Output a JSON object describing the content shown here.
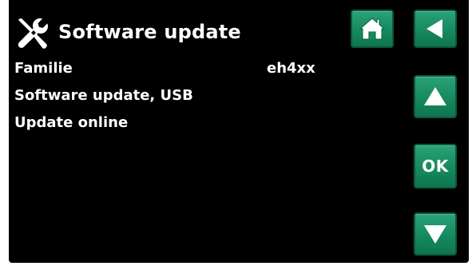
{
  "header": {
    "title": "Software update",
    "title_icon": "tools-icon"
  },
  "nav": {
    "home_icon": "home-icon",
    "back_icon": "back-arrow-icon",
    "up_icon": "up-arrow-icon",
    "ok_label": "OK",
    "down_icon": "down-arrow-icon"
  },
  "menu": {
    "items": [
      {
        "label": "Familie",
        "value": "eh4xx"
      },
      {
        "label": "Software update, USB"
      },
      {
        "label": "Update online"
      }
    ]
  },
  "colors": {
    "background": "#000000",
    "button_green": "#168a5f",
    "text": "#ffffff"
  }
}
